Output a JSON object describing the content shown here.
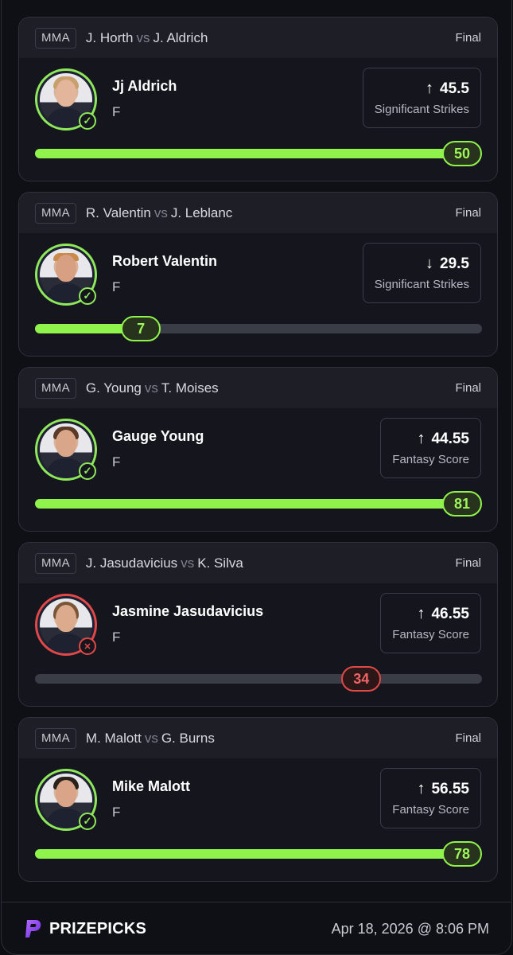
{
  "cards": [
    {
      "league": "MMA",
      "fighter_a": "J. Horth",
      "vs": "vs",
      "fighter_b": "J. Aldrich",
      "status": "Final",
      "player": "Jj Aldrich",
      "position": "F",
      "direction": "up",
      "arrow": "↑",
      "line": "45.5",
      "stat": "Significant Strikes",
      "result": "50",
      "progress": 1.0,
      "outcome": "hit"
    },
    {
      "league": "MMA",
      "fighter_a": "R. Valentin",
      "vs": "vs",
      "fighter_b": "J. Leblanc",
      "status": "Final",
      "player": "Robert Valentin",
      "position": "F",
      "direction": "down",
      "arrow": "↓",
      "line": "29.5",
      "stat": "Significant Strikes",
      "result": "7",
      "progress": 0.237,
      "outcome": "hit"
    },
    {
      "league": "MMA",
      "fighter_a": "G. Young",
      "vs": "vs",
      "fighter_b": "T. Moises",
      "status": "Final",
      "player": "Gauge Young",
      "position": "F",
      "direction": "up",
      "arrow": "↑",
      "line": "44.55",
      "stat": "Fantasy Score",
      "result": "81",
      "progress": 1.0,
      "outcome": "hit"
    },
    {
      "league": "MMA",
      "fighter_a": "J. Jasudavicius",
      "vs": "vs",
      "fighter_b": "K. Silva",
      "status": "Final",
      "player": "Jasmine Jasudavicius",
      "position": "F",
      "direction": "up",
      "arrow": "↑",
      "line": "46.55",
      "stat": "Fantasy Score",
      "result": "34",
      "progress": 0.73,
      "outcome": "miss"
    },
    {
      "league": "MMA",
      "fighter_a": "M. Malott",
      "vs": "vs",
      "fighter_b": "G. Burns",
      "status": "Final",
      "player": "Mike Malott",
      "position": "F",
      "direction": "up",
      "arrow": "↑",
      "line": "56.55",
      "stat": "Fantasy Score",
      "result": "78",
      "progress": 1.0,
      "outcome": "hit"
    }
  ],
  "footer": {
    "brand": "PRIZEPICKS",
    "timestamp": "Apr 18, 2026 @ 8:06 PM"
  },
  "colors": {
    "accent_green": "#8ff34b",
    "miss_red": "#e24848",
    "brand_purple": "#8b3cf6"
  },
  "icons": {
    "check": "check-icon",
    "miss": "x-icon",
    "logo": "prizepicks-logo-icon"
  }
}
